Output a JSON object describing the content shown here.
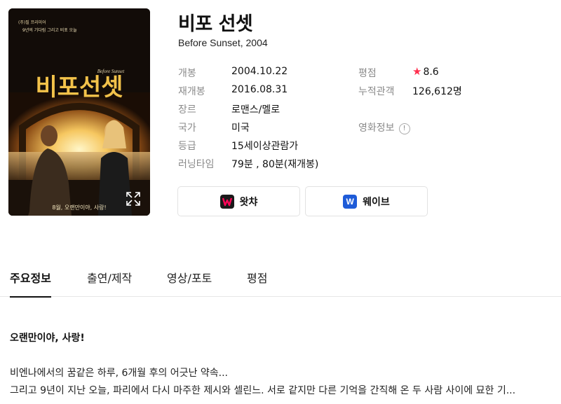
{
  "movie": {
    "title_ko": "비포 선셋",
    "subtitle": "Before Sunset, 2004",
    "poster": {
      "title_text": "비포선셋",
      "tagline_top": "9년의 기다림 그리고 비포 오늘",
      "credit_top": "(주)필 프리미어",
      "english_title": "Before Sunset",
      "tagline_bottom": "8월, 오랜만이야, 사랑!"
    }
  },
  "info_left": [
    {
      "label": "개봉",
      "value": "2004.10.22"
    },
    {
      "label": "재개봉",
      "value": "2016.08.31"
    },
    {
      "label": "장르",
      "value": "로맨스/멜로"
    },
    {
      "label": "국가",
      "value": "미국"
    },
    {
      "label": "등급",
      "value": "15세이상관람가"
    },
    {
      "label": "러닝타임",
      "value": "79분 , 80분(재개봉)"
    }
  ],
  "info_right": {
    "rating_label": "평점",
    "rating_value": "8.6",
    "audience_label": "누적관객",
    "audience_value": "126,612명",
    "movie_info_label": "영화정보",
    "info_icon": "!"
  },
  "ott": [
    {
      "name": "왓챠",
      "logo": "W",
      "color": "#ff0558",
      "logo_bg": "#1a1a1a"
    },
    {
      "name": "웨이브",
      "logo": "W",
      "color": "#1e5bd8",
      "logo_bg": "#1e5bd8"
    }
  ],
  "tabs": [
    "주요정보",
    "출연/제작",
    "영상/포토",
    "평점"
  ],
  "synopsis": {
    "title": "오랜만이야, 사랑!",
    "line1": "비엔나에서의 꿈같은 하루, 6개월 후의 어긋난 약속...",
    "line2": "그리고 9년이 지난 오늘, 파리에서 다시 마주한 제시와 셀린느. 서로 같지만 다른 기억을 간직해 온 두 사람 사이에 묘한 기..."
  },
  "colors": {
    "star": "#ff2f4e",
    "label_gray": "#8a8a8a"
  }
}
